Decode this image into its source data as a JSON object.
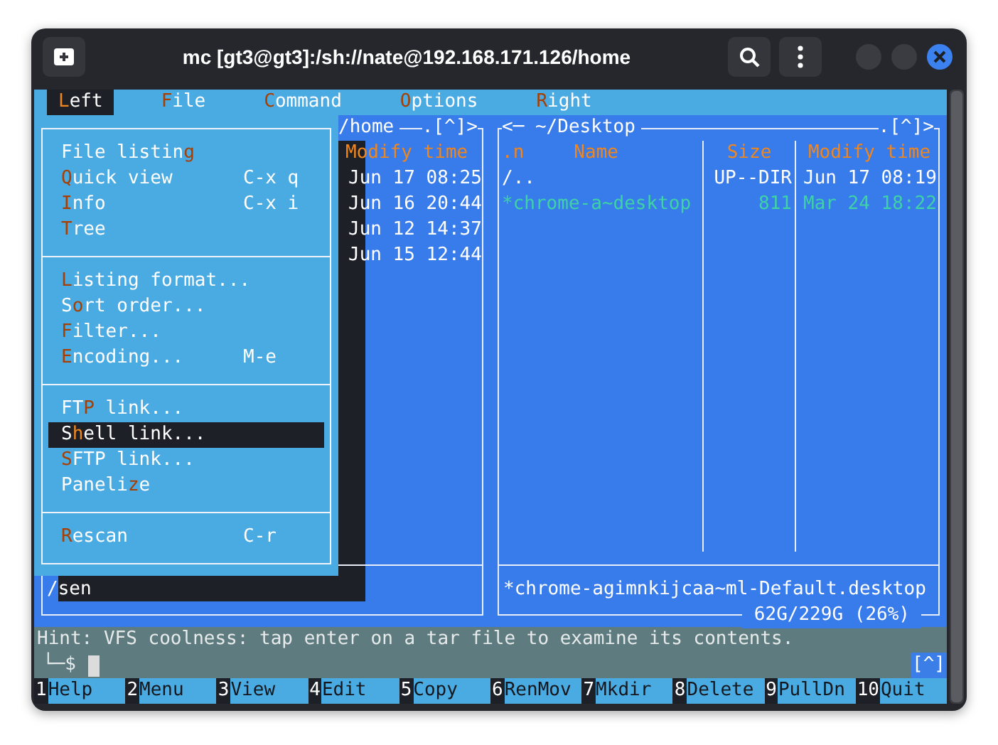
{
  "window": {
    "title": "mc [gt3@gt3]:/sh://nate@192.168.171.126/home"
  },
  "menubar": [
    {
      "key": "L",
      "post": "eft",
      "selected": true
    },
    {
      "key": "F",
      "post": "ile",
      "selected": false
    },
    {
      "key": "C",
      "post": "ommand",
      "selected": false
    },
    {
      "key": "O",
      "post": "ptions",
      "selected": false
    },
    {
      "key": "R",
      "post": "ight",
      "selected": false
    }
  ],
  "left_panel": {
    "path": "/home",
    "flags": ".[^]>",
    "columns": [
      "Modify time"
    ],
    "rows": [
      {
        "time": "Jun 17 08:25"
      },
      {
        "time": "Jun 16 20:44"
      },
      {
        "time": "Jun 12 14:37"
      },
      {
        "time": "Jun 15 12:44"
      }
    ],
    "status": "/sen"
  },
  "right_panel": {
    "path": "<─ ~/Desktop",
    "flags": ".[^]>",
    "sort_mark": ".n",
    "columns": [
      "Name",
      "Size",
      "Modify time"
    ],
    "rows": [
      {
        "name": "/..",
        "size": "UP--DIR",
        "time": "Jun 17 08:19",
        "kind": "updir"
      },
      {
        "name": "*chrome-a~desktop",
        "size": "811",
        "time": "Mar 24 18:22",
        "kind": "exec"
      }
    ],
    "status": "*chrome-agimnkijcaa~ml-Default.desktop",
    "disk": "62G/229G (26%)"
  },
  "menu": {
    "groups": [
      {
        "items": [
          {
            "pre": "File listin",
            "key": "g",
            "selected": false
          },
          {
            "key": "Q",
            "post": "uick view",
            "shortcut": "C-x q",
            "selected": false
          },
          {
            "key": "I",
            "post": "nfo",
            "shortcut": "C-x i",
            "selected": false
          },
          {
            "key": "T",
            "post": "ree",
            "selected": false
          }
        ]
      },
      {
        "items": [
          {
            "key": "L",
            "post": "isting format...",
            "selected": false
          },
          {
            "pre": "S",
            "key": "o",
            "post": "rt order...",
            "selected": false
          },
          {
            "key": "F",
            "post": "ilter...",
            "selected": false
          },
          {
            "key": "E",
            "post": "ncoding...",
            "shortcut": "M-e",
            "selected": false
          }
        ]
      },
      {
        "items": [
          {
            "pre": "FT",
            "key": "P",
            "post": " link...",
            "selected": false
          },
          {
            "pre": "S",
            "key": "h",
            "post": "ell link...",
            "selected": true
          },
          {
            "key": "S",
            "post": "FTP link...",
            "selected": false
          },
          {
            "pre": "Paneli",
            "key": "z",
            "post": "e",
            "selected": false
          }
        ]
      },
      {
        "items": [
          {
            "key": "R",
            "post": "escan",
            "shortcut": "C-r",
            "selected": false
          }
        ]
      }
    ]
  },
  "hint": "Hint: VFS coolness: tap enter on a tar file to examine its contents.",
  "command_line": {
    "prompt": "└─$",
    "corner": "[^]"
  },
  "keybar": [
    {
      "num": "1",
      "label": "Help"
    },
    {
      "num": "2",
      "label": "Menu"
    },
    {
      "num": "3",
      "label": "View"
    },
    {
      "num": "4",
      "label": "Edit"
    },
    {
      "num": "5",
      "label": "Copy"
    },
    {
      "num": "6",
      "label": "RenMov"
    },
    {
      "num": "7",
      "label": "Mkdir"
    },
    {
      "num": "8",
      "label": "Delete"
    },
    {
      "num": "9",
      "label": "PullDn"
    },
    {
      "num": "10",
      "label": "Quit"
    }
  ]
}
